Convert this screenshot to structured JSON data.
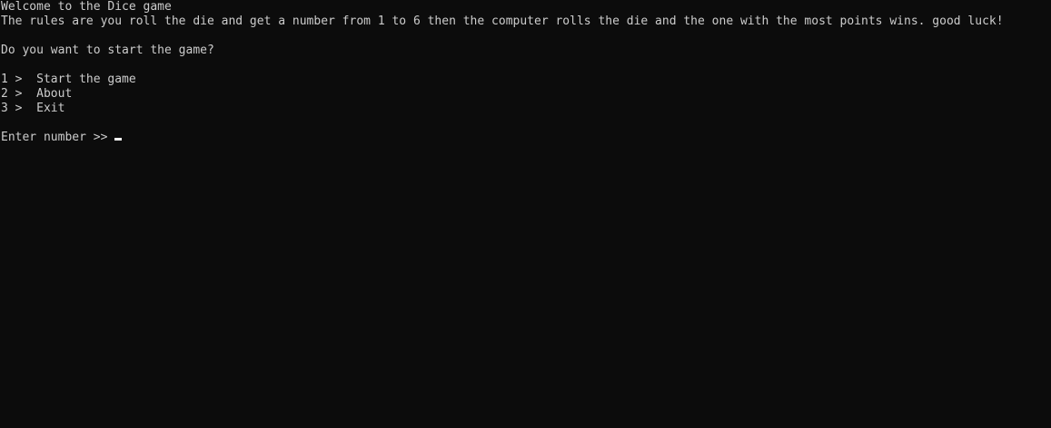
{
  "console": {
    "welcome": "Welcome to the Dice game",
    "rules": "The rules are you roll the die and get a number from 1 to 6 then the computer rolls the die and the one with the most points wins. good luck!",
    "question": "Do you want to start the game?",
    "menu": [
      {
        "number": "1",
        "separator": " >  ",
        "label": "Start the game"
      },
      {
        "number": "2",
        "separator": " >  ",
        "label": "About"
      },
      {
        "number": "3",
        "separator": " >  ",
        "label": "Exit"
      }
    ],
    "prompt": "Enter number >> ",
    "input_value": ""
  },
  "colors": {
    "background": "#0c0c0c",
    "foreground": "#cccccc",
    "cursor": "#f2f2f2"
  }
}
